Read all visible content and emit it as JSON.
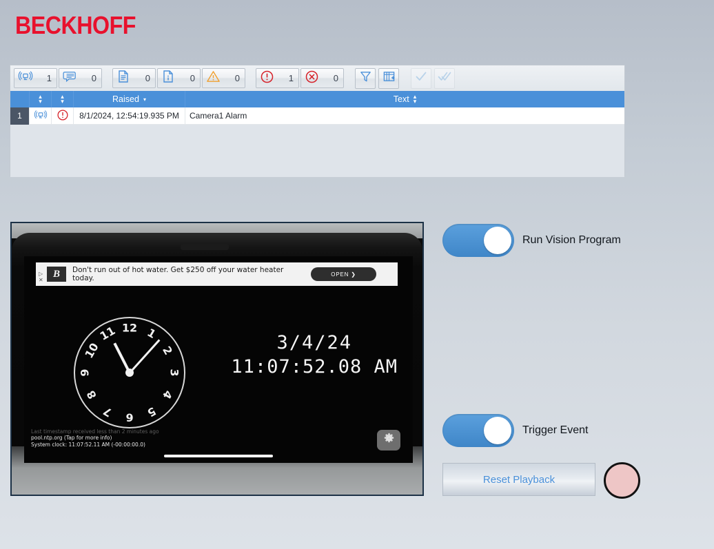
{
  "brand": {
    "name": "BECKHOFF",
    "color": "#e8112d"
  },
  "alarms": {
    "counters": [
      {
        "icon": "broadcast-icon",
        "value": "1"
      },
      {
        "icon": "message-icon",
        "value": "0"
      },
      {
        "icon": "document-icon",
        "value": "0"
      },
      {
        "icon": "info-doc-icon",
        "value": "0"
      },
      {
        "icon": "warning-icon",
        "value": "0"
      },
      {
        "icon": "error-icon",
        "value": "1"
      },
      {
        "icon": "critical-icon",
        "value": "0"
      }
    ],
    "tools": [
      {
        "icon": "filter-icon",
        "enabled": true
      },
      {
        "icon": "add-table-icon",
        "enabled": true
      },
      {
        "icon": "check-icon",
        "enabled": false
      },
      {
        "icon": "double-check-icon",
        "enabled": false
      }
    ],
    "columns": {
      "num": "",
      "source_sort": "sort-arrows-icon",
      "severity_sort": "sort-arrows-icon",
      "raised": "Raised",
      "raised_sort": "sort-desc-icon",
      "text": "Text",
      "text_sort": "sort-arrows-icon"
    },
    "rows": [
      {
        "num": "1",
        "source_icon": "broadcast-icon",
        "severity_icon": "error-icon",
        "raised": "8/1/2024, 12:54:19.935 PM",
        "text": "Camera1 Alarm"
      }
    ]
  },
  "video": {
    "ad": {
      "logo": "B",
      "text": "Don't run out of hot water. Get $250 off your water heater today.",
      "button": "OPEN  ❯",
      "marks": "▷\n✕"
    },
    "analog_clock": {
      "numerals": [
        "12",
        "1",
        "2",
        "3",
        "4",
        "5",
        "6",
        "7",
        "8",
        "9",
        "10",
        "11"
      ]
    },
    "digital": {
      "date": "3/4/24",
      "time": "11:07:52.08 AM"
    },
    "status": {
      "line1": "Last timestamp received less than 2 minutes ago",
      "line2": "pool.ntp.org (Tap for more info)",
      "line3": "System clock: 11:07:52.11 AM (-00:00:00.0)"
    },
    "gear": "gear-icon"
  },
  "controls": {
    "run_vision": {
      "label": "Run Vision Program",
      "state": "on"
    },
    "trigger_event": {
      "label": "Trigger Event",
      "state": "on"
    },
    "reset_button": "Reset Playback",
    "indicator": {
      "name": "status-lamp",
      "color": "#eec6c6"
    }
  }
}
